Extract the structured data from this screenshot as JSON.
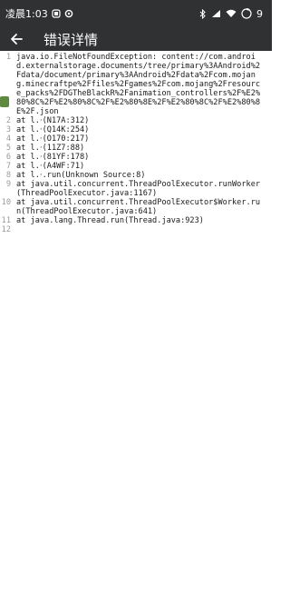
{
  "status_bar": {
    "time": "凌晨1:03",
    "battery_level": "9",
    "icons": [
      "notification-icon",
      "settings-icon",
      "bluetooth-icon",
      "signal-icon",
      "wifi-icon",
      "battery-icon"
    ]
  },
  "app_bar": {
    "title": "错误详情",
    "back_icon": "arrow-back-icon"
  },
  "colors": {
    "bar_bg": "#2f3133",
    "text": "#1a1a1a",
    "gutter_text": "#9a9a9a",
    "marker": "#5d8a3c"
  },
  "log": {
    "lines": [
      {
        "num": "1",
        "text": "java.io.FileNotFoundException: content://com.android.externalstorage.documents/tree/primary%3AAndroid%2Fdata/document/primary%3AAndroid%2Fdata%2Fcom.mojang.minecraftpe%2Ffiles%2Fgames%2Fcom.mojang%2Fresource_packs%2FDGTheBlackR%2Fanimation_controllers%2F%E2%80%8C%2F%E2%80%8C%2F%E2%80%8E%2F%E2%80%8C%2F%E2%80%8E%2F.json"
      },
      {
        "num": "2",
        "text": "at l.‧(N17A:312)"
      },
      {
        "num": "3",
        "text": "at l.‧(Q14K:254)"
      },
      {
        "num": "4",
        "text": "at l.‧(O170:217)"
      },
      {
        "num": "5",
        "text": "at l.‧(11Z7:88)"
      },
      {
        "num": "6",
        "text": "at l.‧(81YF:178)"
      },
      {
        "num": "7",
        "text": "at l.‧(A4WF:71)"
      },
      {
        "num": "8",
        "text": "at l.‧.run(Unknown Source:8)"
      },
      {
        "num": "9",
        "text": "at java.util.concurrent.ThreadPoolExecutor.runWorker(ThreadPoolExecutor.java:1167)"
      },
      {
        "num": "10",
        "text": "at java.util.concurrent.ThreadPoolExecutor$Worker.run(ThreadPoolExecutor.java:641)"
      },
      {
        "num": "11",
        "text": "at java.lang.Thread.run(Thread.java:923)"
      },
      {
        "num": "12",
        "text": ""
      }
    ]
  }
}
